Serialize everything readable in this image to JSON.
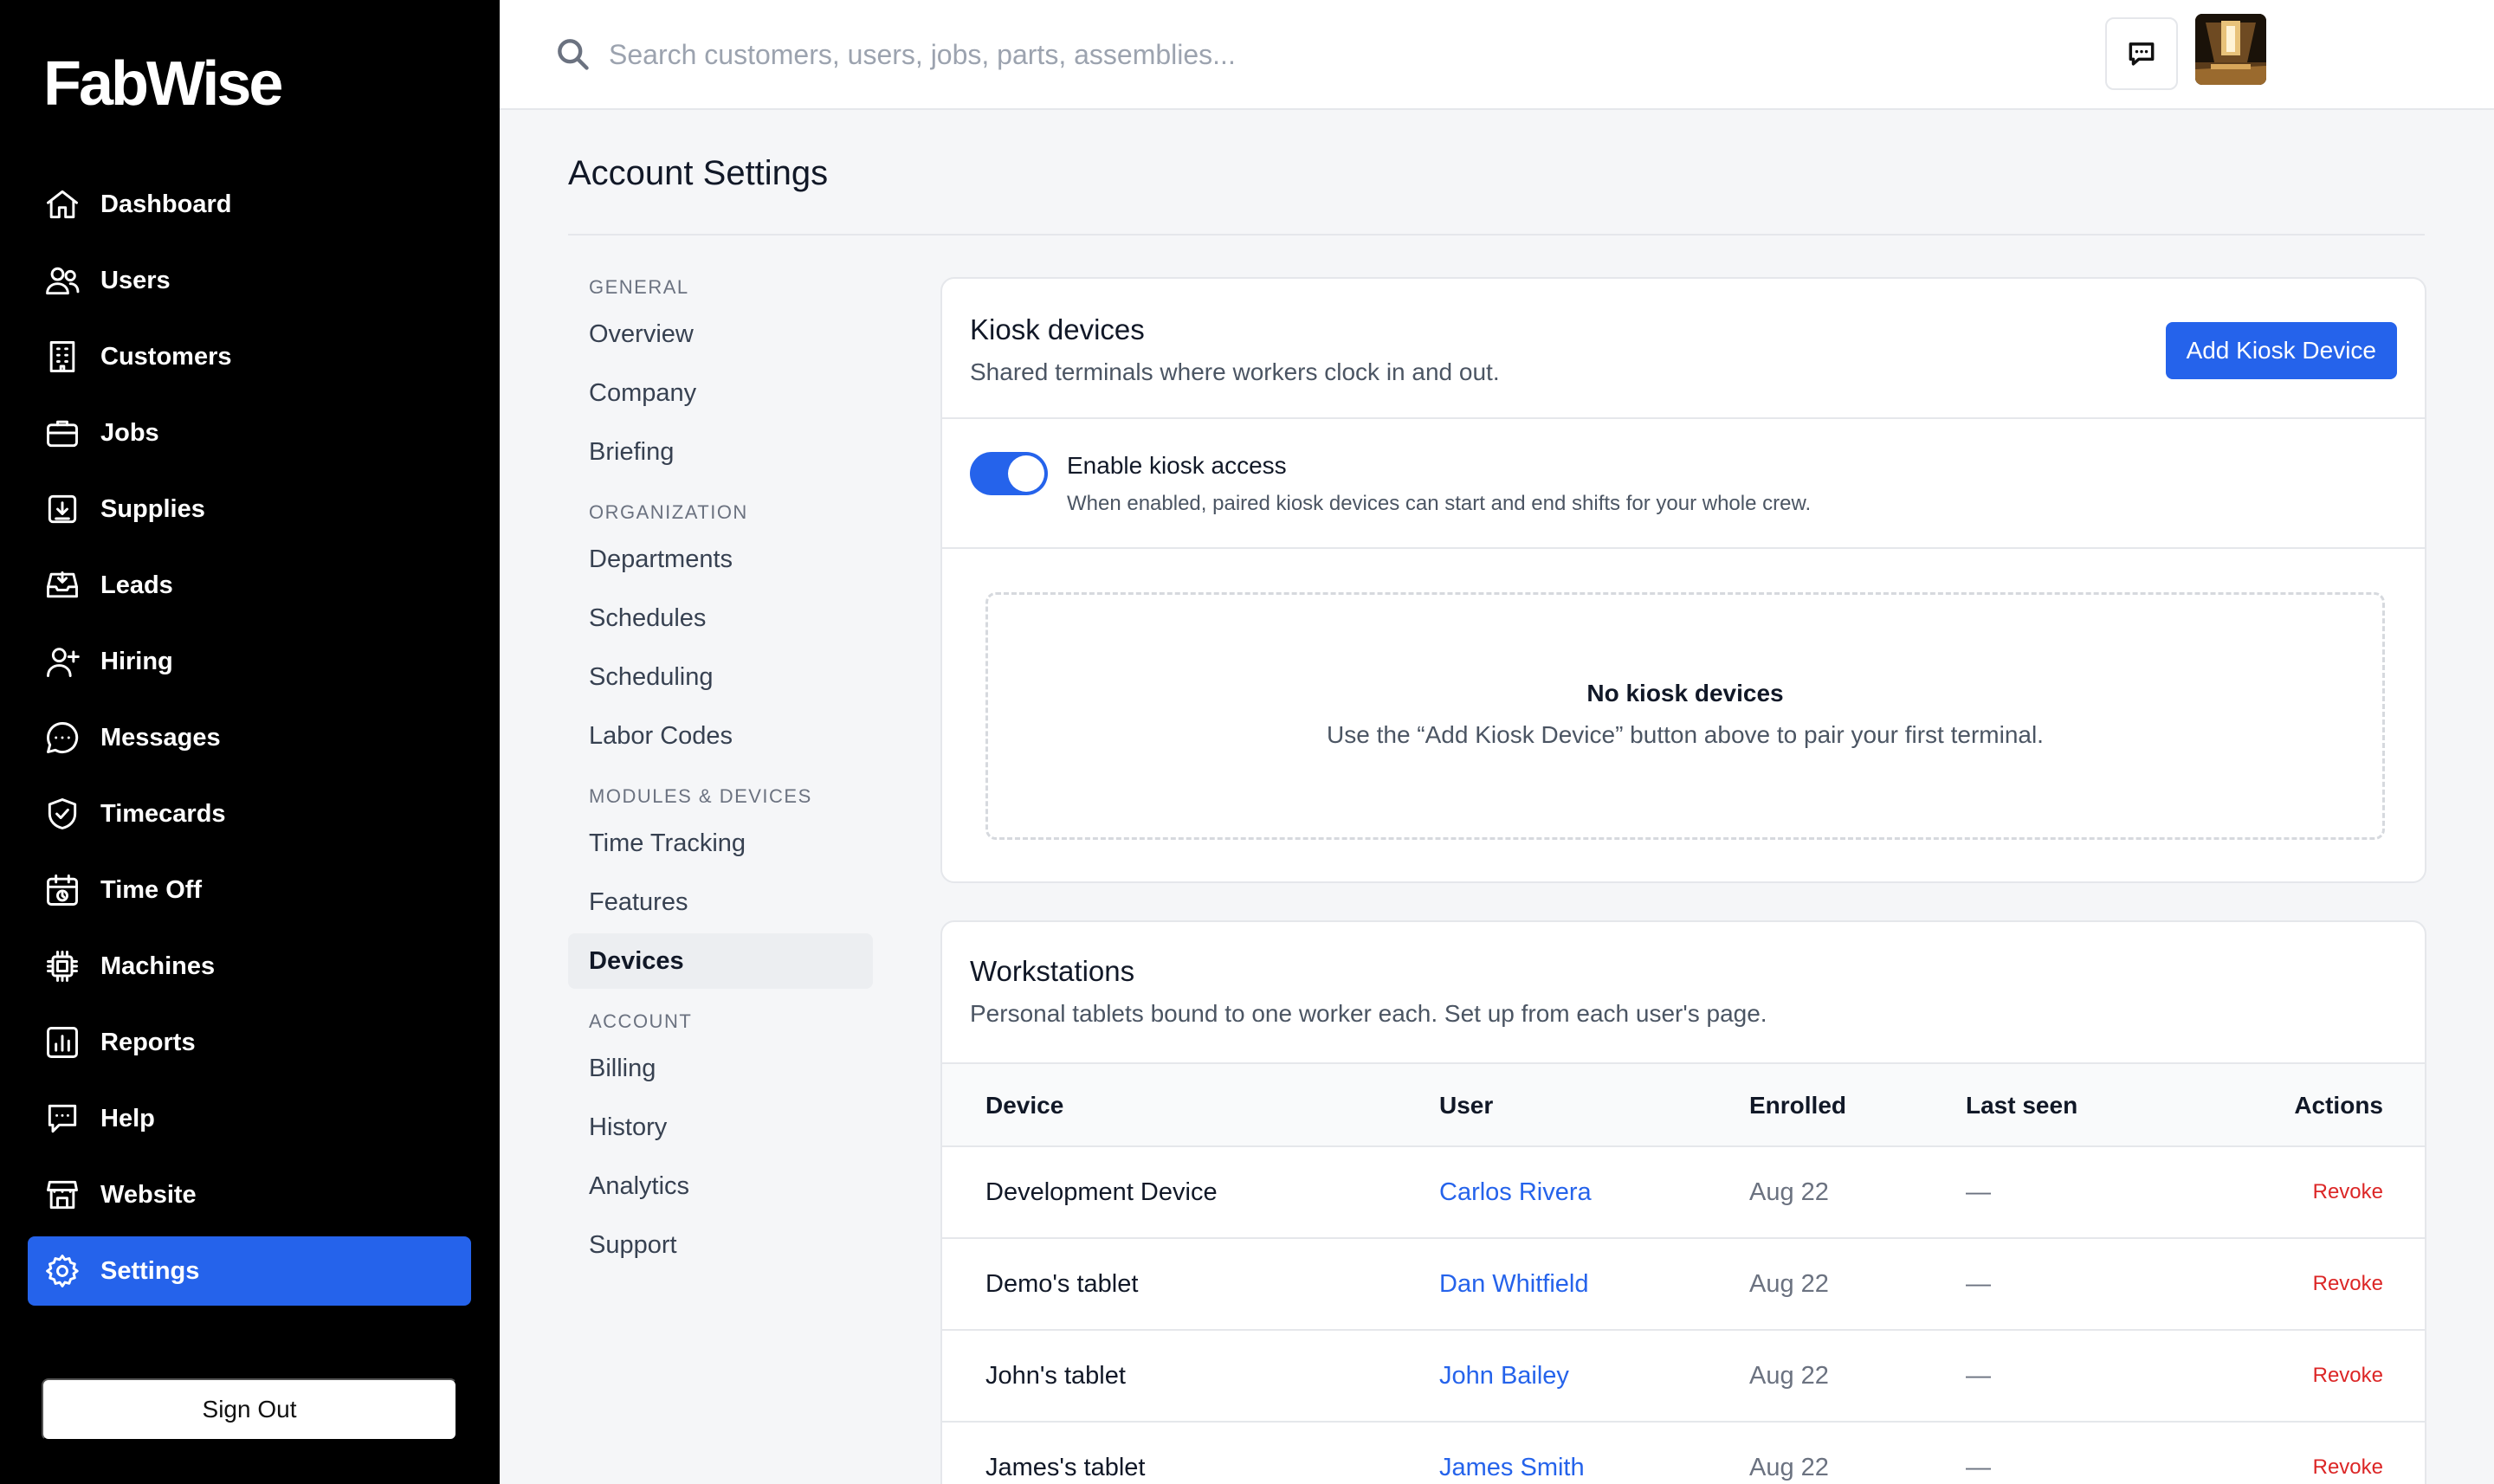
{
  "app": {
    "name": "FabWise"
  },
  "sidebar": {
    "items": [
      {
        "label": "Dashboard",
        "icon": "home-icon"
      },
      {
        "label": "Users",
        "icon": "users-icon"
      },
      {
        "label": "Customers",
        "icon": "building-icon"
      },
      {
        "label": "Jobs",
        "icon": "briefcase-icon"
      },
      {
        "label": "Supplies",
        "icon": "box-download-icon"
      },
      {
        "label": "Leads",
        "icon": "inbox-icon"
      },
      {
        "label": "Hiring",
        "icon": "user-plus-icon"
      },
      {
        "label": "Messages",
        "icon": "chat-bubble-icon"
      },
      {
        "label": "Timecards",
        "icon": "shield-check-icon"
      },
      {
        "label": "Time Off",
        "icon": "calendar-clock-icon"
      },
      {
        "label": "Machines",
        "icon": "cpu-chip-icon"
      },
      {
        "label": "Reports",
        "icon": "bar-chart-icon"
      },
      {
        "label": "Help",
        "icon": "help-chat-icon"
      },
      {
        "label": "Website",
        "icon": "storefront-icon"
      },
      {
        "label": "Settings",
        "icon": "gear-icon",
        "active": true
      }
    ],
    "signout_label": "Sign Out"
  },
  "topbar": {
    "search_placeholder": "Search customers, users, jobs, parts, assemblies..."
  },
  "page": {
    "title": "Account Settings"
  },
  "subnav": {
    "general": {
      "label": "GENERAL",
      "items": [
        "Overview",
        "Company",
        "Briefing"
      ]
    },
    "organization": {
      "label": "ORGANIZATION",
      "items": [
        "Departments",
        "Schedules",
        "Scheduling",
        "Labor Codes"
      ]
    },
    "modules": {
      "label": "MODULES & DEVICES",
      "items": [
        "Time Tracking",
        "Features",
        "Devices"
      ]
    },
    "account": {
      "label": "ACCOUNT",
      "items": [
        "Billing",
        "History",
        "Analytics",
        "Support"
      ]
    },
    "active": "Devices"
  },
  "kiosk": {
    "title": "Kiosk devices",
    "subtitle": "Shared terminals where workers clock in and out.",
    "add_button": "Add Kiosk Device",
    "toggle": {
      "label": "Enable kiosk access",
      "description": "When enabled, paired kiosk devices can start and end shifts for your whole crew.",
      "enabled": true
    },
    "empty": {
      "title": "No kiosk devices",
      "description": "Use the “Add Kiosk Device” button above to pair your first terminal."
    }
  },
  "workstations": {
    "title": "Workstations",
    "subtitle": "Personal tablets bound to one worker each. Set up from each user's page.",
    "columns": [
      "Device",
      "User",
      "Enrolled",
      "Last seen",
      "Actions"
    ],
    "rows": [
      {
        "device": "Development Device",
        "user": "Carlos Rivera",
        "enrolled": "Aug 22",
        "last_seen": "—",
        "action": "Revoke"
      },
      {
        "device": "Demo's tablet",
        "user": "Dan Whitfield",
        "enrolled": "Aug 22",
        "last_seen": "—",
        "action": "Revoke"
      },
      {
        "device": "John's tablet",
        "user": "John Bailey",
        "enrolled": "Aug 22",
        "last_seen": "—",
        "action": "Revoke"
      },
      {
        "device": "James's tablet",
        "user": "James Smith",
        "enrolled": "Aug 22",
        "last_seen": "—",
        "action": "Revoke"
      }
    ]
  },
  "colors": {
    "accent": "#2563eb",
    "sidebar_bg": "#000000",
    "danger": "#dc2626"
  }
}
